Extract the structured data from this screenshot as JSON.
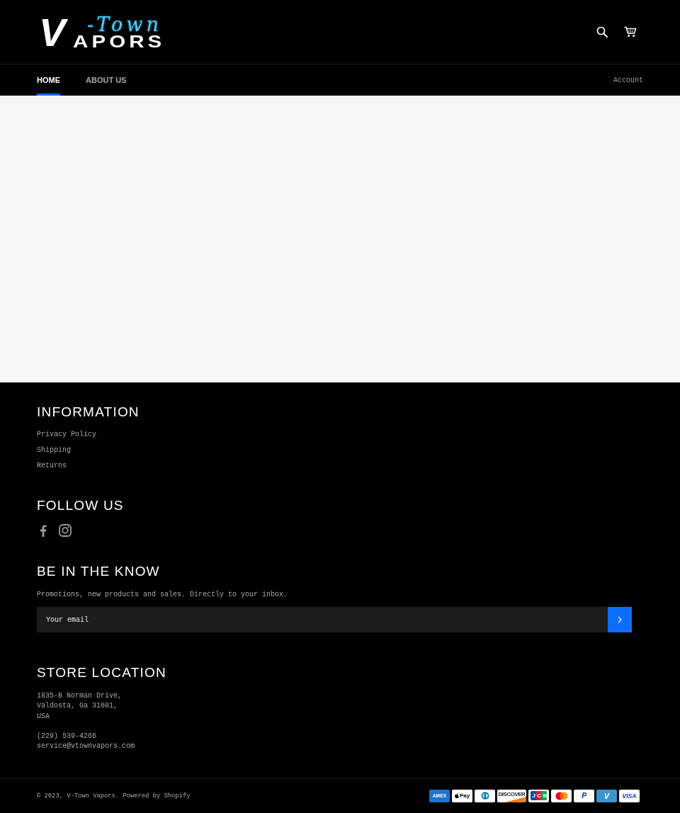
{
  "header": {
    "logo": {
      "mark": "V",
      "script": "-Town",
      "wordmark": "APORS"
    }
  },
  "nav": {
    "items": [
      {
        "label": "HOME",
        "selected": true
      },
      {
        "label": "ABOUT US",
        "selected": false
      }
    ],
    "account": "Account"
  },
  "footer": {
    "information": {
      "title": "INFORMATION",
      "links": [
        "Privacy Policy",
        "Shipping",
        "Returns"
      ]
    },
    "follow": {
      "title": "FOLLOW US",
      "networks": [
        {
          "kind": "facebook"
        },
        {
          "kind": "instagram"
        }
      ]
    },
    "newsletter": {
      "title": "BE IN THE KNOW",
      "text": "Promotions, new products and sales. Directly to your inbox.",
      "placeholder": "Your email"
    },
    "store": {
      "title": "STORE LOCATION",
      "address_lines": [
        "1835-B Norman Drive,",
        "Valdosta, Ga 31601,",
        "USA"
      ],
      "phone": "(229) 539-4266",
      "email": "service@vtownvapors.com"
    },
    "copyright": "© 2023, V-Town Vapors. Powered by Shopify",
    "payment_methods": [
      {
        "kind": "amex",
        "label": "AMEX"
      },
      {
        "kind": "apple_pay",
        "label": "Pay"
      },
      {
        "kind": "diners"
      },
      {
        "kind": "discover",
        "label": "DISCOVER"
      },
      {
        "kind": "jcb",
        "label": "JCB"
      },
      {
        "kind": "mastercard"
      },
      {
        "kind": "paypal",
        "label": "P"
      },
      {
        "kind": "venmo",
        "label": "V"
      },
      {
        "kind": "visa",
        "label": "VISA"
      }
    ]
  }
}
